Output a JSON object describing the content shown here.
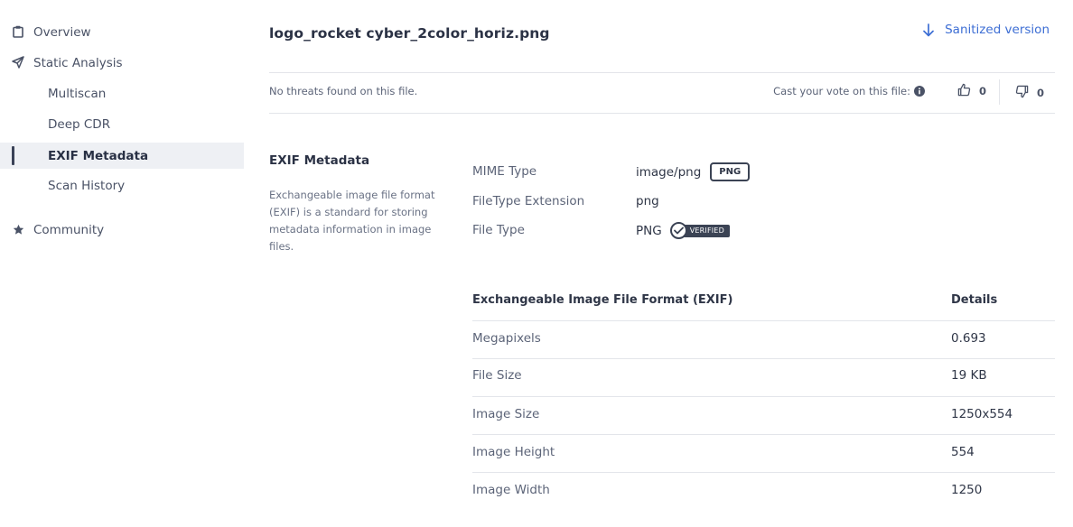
{
  "sidebar": {
    "items": [
      {
        "label": "Overview"
      },
      {
        "label": "Static Analysis"
      },
      {
        "label": "Multiscan"
      },
      {
        "label": "Deep CDR"
      },
      {
        "label": "EXIF Metadata"
      },
      {
        "label": "Scan History"
      },
      {
        "label": "Community"
      }
    ],
    "active": "EXIF Metadata"
  },
  "header": {
    "file_name": "logo_rocket cyber_2color_horiz.png",
    "sanitized_label": "Sanitized version"
  },
  "status": {
    "message": "No threats found on this file.",
    "vote_label": "Cast your vote on this file:",
    "upvotes": "0",
    "downvotes": "0"
  },
  "section": {
    "title": "EXIF Metadata",
    "description": "Exchangeable image file format (EXIF) is a standard for storing metadata information in image files."
  },
  "summary": {
    "mime_key": "MIME Type",
    "mime_val": "image/png",
    "mime_badge": "PNG",
    "ext_key": "FileType Extension",
    "ext_val": "png",
    "type_key": "File Type",
    "type_val": "PNG",
    "verified_badge": "VERIFIED"
  },
  "table": {
    "headers": [
      "Exchangeable Image File Format (EXIF)",
      "Details"
    ],
    "rows": [
      {
        "key": "Megapixels",
        "value": "0.693"
      },
      {
        "key": "File Size",
        "value": "19 KB"
      },
      {
        "key": "Image Size",
        "value": "1250x554"
      },
      {
        "key": "Image Height",
        "value": "554"
      },
      {
        "key": "Image Width",
        "value": "1250"
      }
    ]
  },
  "colors": {
    "accent": "#3d6ed4",
    "text_dark": "#2b3245",
    "active_bg": "#eef0f4"
  },
  "icons": {
    "overview": "clipboard-icon",
    "static_analysis": "paper-plane-icon",
    "community": "star-icon",
    "sanitized": "arrow-down-icon",
    "info": "info-circle-icon",
    "upvote": "thumbs-up-icon",
    "downvote": "thumbs-down-icon",
    "verified": "check-circle-icon"
  }
}
